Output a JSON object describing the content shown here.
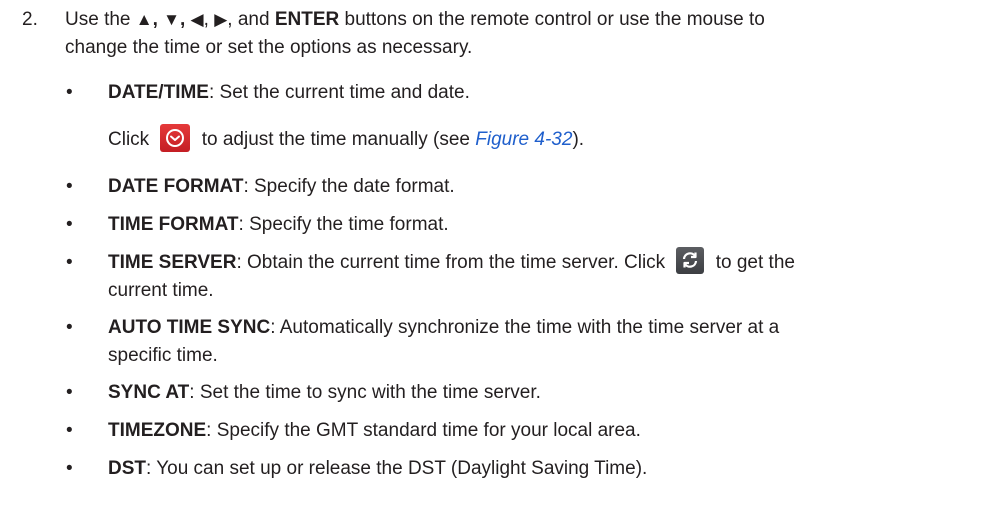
{
  "step": {
    "number": "2.",
    "intro_pre": "Use the ",
    "arrow_up": "▲",
    "sep1": ", ",
    "arrow_down": "▼",
    "sep2": ", ",
    "arrow_left": "◀",
    "sep3": ", ",
    "arrow_right": "▶",
    "sep4": ", and ",
    "enter": "ENTER",
    "intro_post": " buttons on the remote control or use the mouse to",
    "intro_line2": "change the time or set the options as necessary."
  },
  "items": [
    {
      "term": "DATE/TIME",
      "desc": ": Set the current time and date."
    },
    {
      "term": "DATE FORMAT",
      "desc": ": Specify the date format."
    },
    {
      "term": "TIME FORMAT",
      "desc": ": Specify the time format."
    },
    {
      "term": "TIME SERVER",
      "desc": ": Obtain the current time from the time server. Click ",
      "desc_after_icon": " to get the",
      "desc_line2": "current time."
    },
    {
      "term": "AUTO TIME SYNC",
      "desc": ": Automatically synchronize the time with the time server at a",
      "desc_line2": "specific time."
    },
    {
      "term": "SYNC AT",
      "desc": ": Set the time to sync with the time server."
    },
    {
      "term": "TIMEZONE",
      "desc": ": Specify the GMT standard time for your local area."
    },
    {
      "term": "DST",
      "desc": ": You can set up or release the DST (Daylight Saving Time)."
    }
  ],
  "datetime_note": {
    "pre": "Click ",
    "post": " to adjust the time manually (see ",
    "link": "Figure 4-32",
    "end": ")."
  },
  "icons": {
    "clock": "clock-icon",
    "sync": "sync-icon"
  },
  "bullet_char": "•",
  "colors": {
    "text": "#231f20",
    "link": "#1f5fcc",
    "clock_button": "#d42a2e",
    "sync_button": "#4a4c50"
  }
}
